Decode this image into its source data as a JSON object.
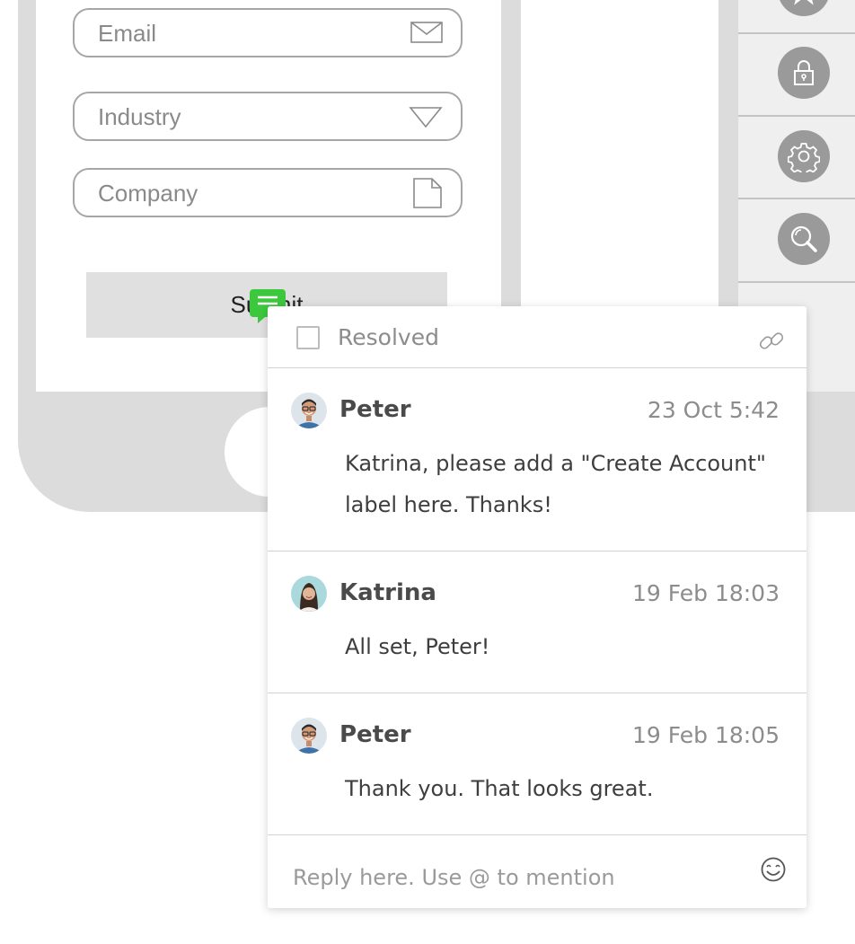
{
  "form": {
    "email_placeholder": "Email",
    "industry_placeholder": "Industry",
    "company_placeholder": "Company",
    "submit_label": "Submit"
  },
  "toolbar": {
    "items": [
      {
        "icon": "star-icon"
      },
      {
        "icon": "lock-icon"
      },
      {
        "icon": "gear-icon"
      },
      {
        "icon": "search-icon"
      }
    ]
  },
  "comment_panel": {
    "resolved_label": "Resolved",
    "resolved_checked": false,
    "comments": [
      {
        "author": "Peter",
        "time": "23 Oct 5:42",
        "text": "Katrina, please add a \"Create Account\" label here. Thanks!"
      },
      {
        "author": "Katrina",
        "time": "19 Feb 18:03",
        "text": "All set, Peter!"
      },
      {
        "author": "Peter",
        "time": "19 Feb 18:05",
        "text": "Thank you. That looks great."
      }
    ],
    "reply_placeholder": "Reply here. Use @ to mention"
  },
  "colors": {
    "marker_green": "#3cc83c",
    "phone_gray": "#dcdcdc",
    "tool_button": "#9a9a9a"
  }
}
